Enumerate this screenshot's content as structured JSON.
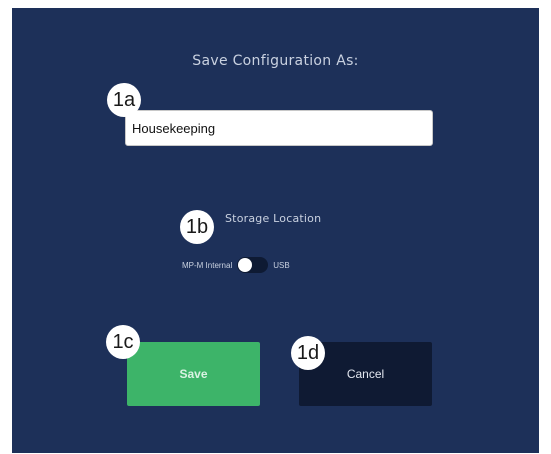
{
  "dialog": {
    "title": "Save Configuration As:",
    "name_input": {
      "value": "Housekeeping",
      "placeholder": ""
    },
    "storage": {
      "label": "Storage Location",
      "left_option": "MP-M Internal",
      "right_option": "USB",
      "selected": "MP-M Internal"
    },
    "save_label": "Save",
    "cancel_label": "Cancel"
  },
  "callouts": {
    "input": "1a",
    "storage": "1b",
    "save": "1c",
    "cancel": "1d"
  },
  "colors": {
    "background": "#1d3059",
    "save_button": "#3db469",
    "cancel_button": "#0f1a33",
    "toggle_track": "#0e1a33"
  }
}
